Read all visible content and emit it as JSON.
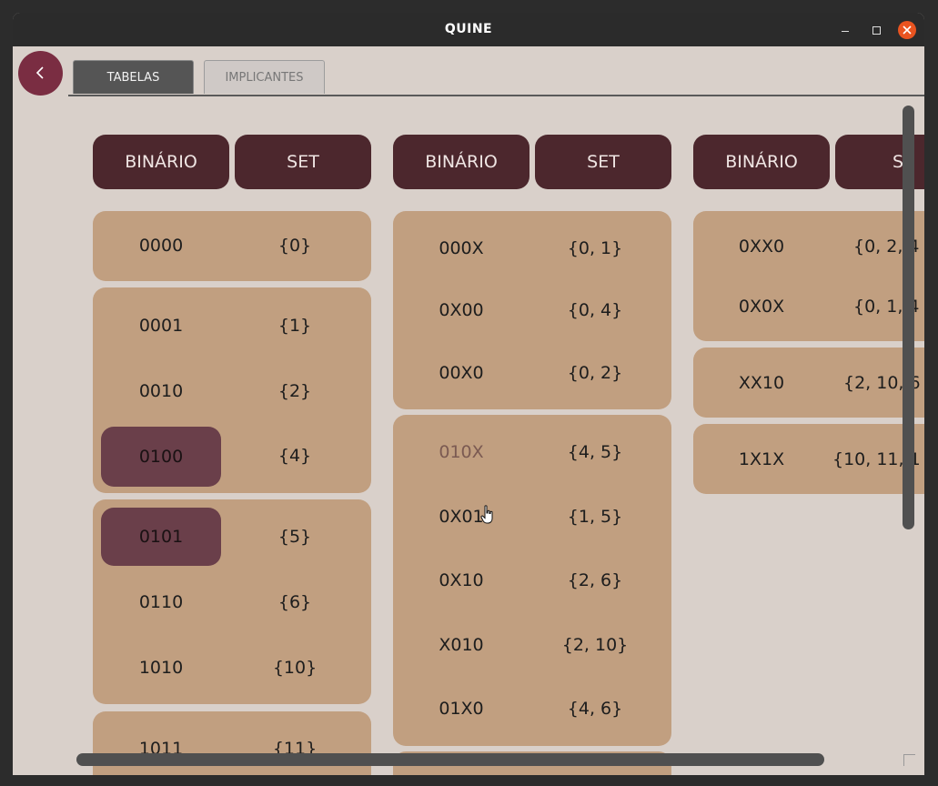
{
  "window": {
    "title": "QUINE"
  },
  "tabs": {
    "active": "TABELAS",
    "inactive": "IMPLICANTES"
  },
  "headers": {
    "binary": "BINÁRIO",
    "set": "SET",
    "set_cut": "SE"
  },
  "col1": [
    {
      "bin": "0000",
      "set": "{0}"
    },
    {
      "bin": "0001",
      "set": "{1}"
    },
    {
      "bin": "0010",
      "set": "{2}"
    },
    {
      "bin": "0100",
      "set": "{4}"
    },
    {
      "bin": "0101",
      "set": "{5}"
    },
    {
      "bin": "0110",
      "set": "{6}"
    },
    {
      "bin": "1010",
      "set": "{10}"
    },
    {
      "bin": "1011",
      "set": "{11}"
    }
  ],
  "col2": [
    {
      "bin": "000X",
      "set": "{0, 1}"
    },
    {
      "bin": "0X00",
      "set": "{0, 4}"
    },
    {
      "bin": "00X0",
      "set": "{0, 2}"
    },
    {
      "bin": "010X",
      "set": "{4, 5}"
    },
    {
      "bin": "0X01",
      "set": "{1, 5}"
    },
    {
      "bin": "0X10",
      "set": "{2, 6}"
    },
    {
      "bin": "X010",
      "set": "{2, 10}"
    },
    {
      "bin": "01X0",
      "set": "{4, 6}"
    }
  ],
  "col3": [
    {
      "bin": "0XX0",
      "set": "{0, 2, 4"
    },
    {
      "bin": "0X0X",
      "set": "{0, 1, 4"
    },
    {
      "bin": "XX10",
      "set": "{2, 10, 6"
    },
    {
      "bin": "1X1X",
      "set": "{10, 11, 1"
    }
  ],
  "icons": [
    "chevron-left-icon",
    "minimize-icon",
    "maximize-icon",
    "close-icon",
    "hand-cursor-icon"
  ],
  "colors": {
    "header": "#4c272d",
    "group": "#c19f80",
    "highlight": "#6a3f4a",
    "back_button": "#7a2d42",
    "background": "#d9d0ca"
  }
}
